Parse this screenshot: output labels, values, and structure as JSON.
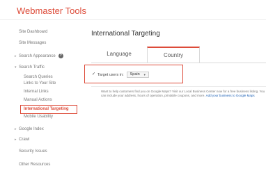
{
  "app": {
    "title": "Webmaster Tools"
  },
  "sidebar": {
    "items": [
      {
        "label": "Site Dashboard"
      },
      {
        "label": "Site Messages"
      },
      {
        "label": "Search Appearance"
      },
      {
        "label": "Search Traffic"
      },
      {
        "label": "Search Queries"
      },
      {
        "label": "Links to Your Site"
      },
      {
        "label": "Internal Links"
      },
      {
        "label": "Manual Actions"
      },
      {
        "label": "International Targeting"
      },
      {
        "label": "Mobile Usability"
      },
      {
        "label": "Google Index"
      },
      {
        "label": "Crawl"
      },
      {
        "label": "Security Issues"
      },
      {
        "label": "Other Resources"
      }
    ],
    "help_icon": "help-icon",
    "active_color": "#dd4b39"
  },
  "main": {
    "title": "International Targeting",
    "tabs": [
      {
        "label": "Language"
      },
      {
        "label": "Country"
      }
    ],
    "target": {
      "label": "Target users in:",
      "selected": "Spain"
    },
    "description": {
      "text": "Want to help customers find you on Google Maps? Visit our Local Business Center now for a free business listing. You can include your address, hours of operation, printable coupons, and more.",
      "link": "Add your business to Google Maps"
    }
  }
}
